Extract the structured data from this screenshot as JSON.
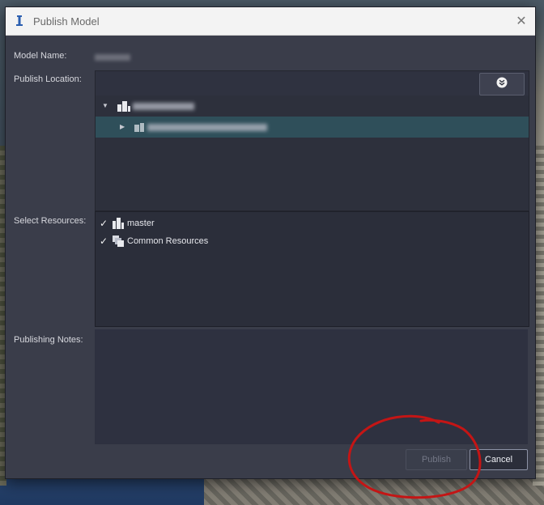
{
  "window": {
    "title": "Publish Model",
    "close_glyph": "✕",
    "icon": "app-info-icon"
  },
  "form": {
    "model_name_label": "Model Name:",
    "publish_location_label": "Publish Location:",
    "select_resources_label": "Select Resources:",
    "publishing_notes_label": "Publishing Notes:"
  },
  "publish_location": {
    "search_icon": "filter-expand-icon",
    "tree": [
      {
        "expanded": true,
        "selected": false,
        "level": 0
      },
      {
        "expanded": false,
        "selected": true,
        "level": 1
      }
    ]
  },
  "resources": [
    {
      "label": "master",
      "checked": true,
      "icon": "model-icon"
    },
    {
      "label": "Common Resources",
      "checked": true,
      "icon": "resources-icon"
    }
  ],
  "buttons": {
    "publish": "Publish",
    "cancel": "Cancel"
  },
  "colors": {
    "dialog_bg": "#3a3d4a",
    "selection": "#2f4f5a",
    "annotation": "#c41515"
  }
}
